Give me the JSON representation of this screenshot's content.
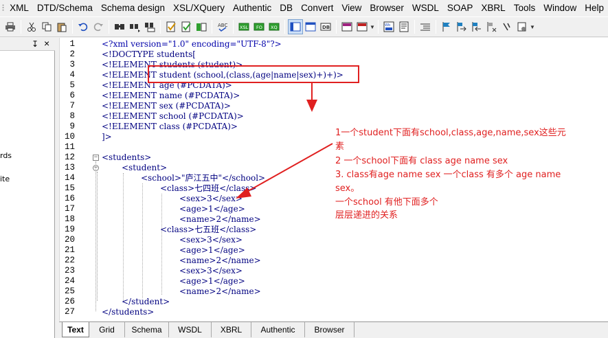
{
  "menu": [
    "XML",
    "DTD/Schema",
    "Schema design",
    "XSL/XQuery",
    "Authentic",
    "DB",
    "Convert",
    "View",
    "Browser",
    "WSDL",
    "SOAP",
    "XBRL",
    "Tools",
    "Window",
    "Help"
  ],
  "left_pane": {
    "pin": "↧",
    "close": "×",
    "fragments": [
      "rds",
      "ite"
    ]
  },
  "editor": {
    "line_numbers": [
      "1",
      "2",
      "3",
      "4",
      "5",
      "6",
      "7",
      "8",
      "9",
      "10",
      "11",
      "12",
      "13",
      "14",
      "15",
      "16",
      "17",
      "18",
      "19",
      "20",
      "21",
      "22",
      "23",
      "24",
      "25",
      "26",
      "27"
    ],
    "lines": [
      "<?xml version=\"1.0\" encoding=\"UTF-8\"?>",
      "<!DOCTYPE students[",
      "<!ELEMENT students (student)>",
      "<!ELEMENT student (school,(class,(age|name|sex)+)+)>",
      "<!ELEMENT age (#PCDATA)>",
      "<!ELEMENT name (#PCDATA)>",
      "<!ELEMENT sex (#PCDATA)>",
      "<!ELEMENT school (#PCDATA)>",
      "<!ELEMENT class (#PCDATA)>",
      "]>",
      "",
      "<students>",
      "<student>",
      "<school>\"庐江五中\"</school>",
      "<class>七四班</class>",
      "<sex>3</sex>",
      "<age>1</age>",
      "<name>2</name>",
      "<class>七五班</class>",
      "<sex>3</sex>",
      "<age>1</age>",
      "<name>2</name>",
      "<sex>3</sex>",
      "<age>1</age>",
      "<name>2</name>",
      "</student>",
      "</students>"
    ]
  },
  "annotation": {
    "lines": [
      "1一个student下面有school,class,age,name,sex这些元",
      "素",
      "2 一个school下面有 class age name sex",
      "3. class有age name sex 一个class 有多个 age name",
      "sex。",
      "一个school 有他下面多个",
      "层层递进的关系"
    ],
    "color": "#e02020"
  },
  "tabs": [
    {
      "label": "Text",
      "active": true
    },
    {
      "label": "Grid",
      "active": false
    },
    {
      "label": "Schema",
      "active": false
    },
    {
      "label": "WSDL",
      "active": false
    },
    {
      "label": "XBRL",
      "active": false
    },
    {
      "label": "Authentic",
      "active": false
    },
    {
      "label": "Browser",
      "active": false
    }
  ],
  "toolbar_icons": [
    "print-icon",
    "cut-icon",
    "copy-icon",
    "paste-icon",
    "undo-icon",
    "redo-icon",
    "find-icon",
    "find-next-icon",
    "replace-icon",
    "check-well-formed-icon",
    "validate-icon",
    "validate-green-icon",
    "spellcheck-icon",
    "xsl-transform-icon",
    "fo-transform-icon",
    "xq-transform-icon",
    "text-view-icon",
    "grid-view-icon",
    "db-view-icon",
    "dtd-icon",
    "schema-icon",
    "wsdl-icon",
    "authentic-icon",
    "indent-icon",
    "bookmark-icon",
    "bookmark-next-icon",
    "bookmark-prev-icon",
    "bookmark-clear-icon",
    "comment-icon",
    "settings-icon"
  ]
}
